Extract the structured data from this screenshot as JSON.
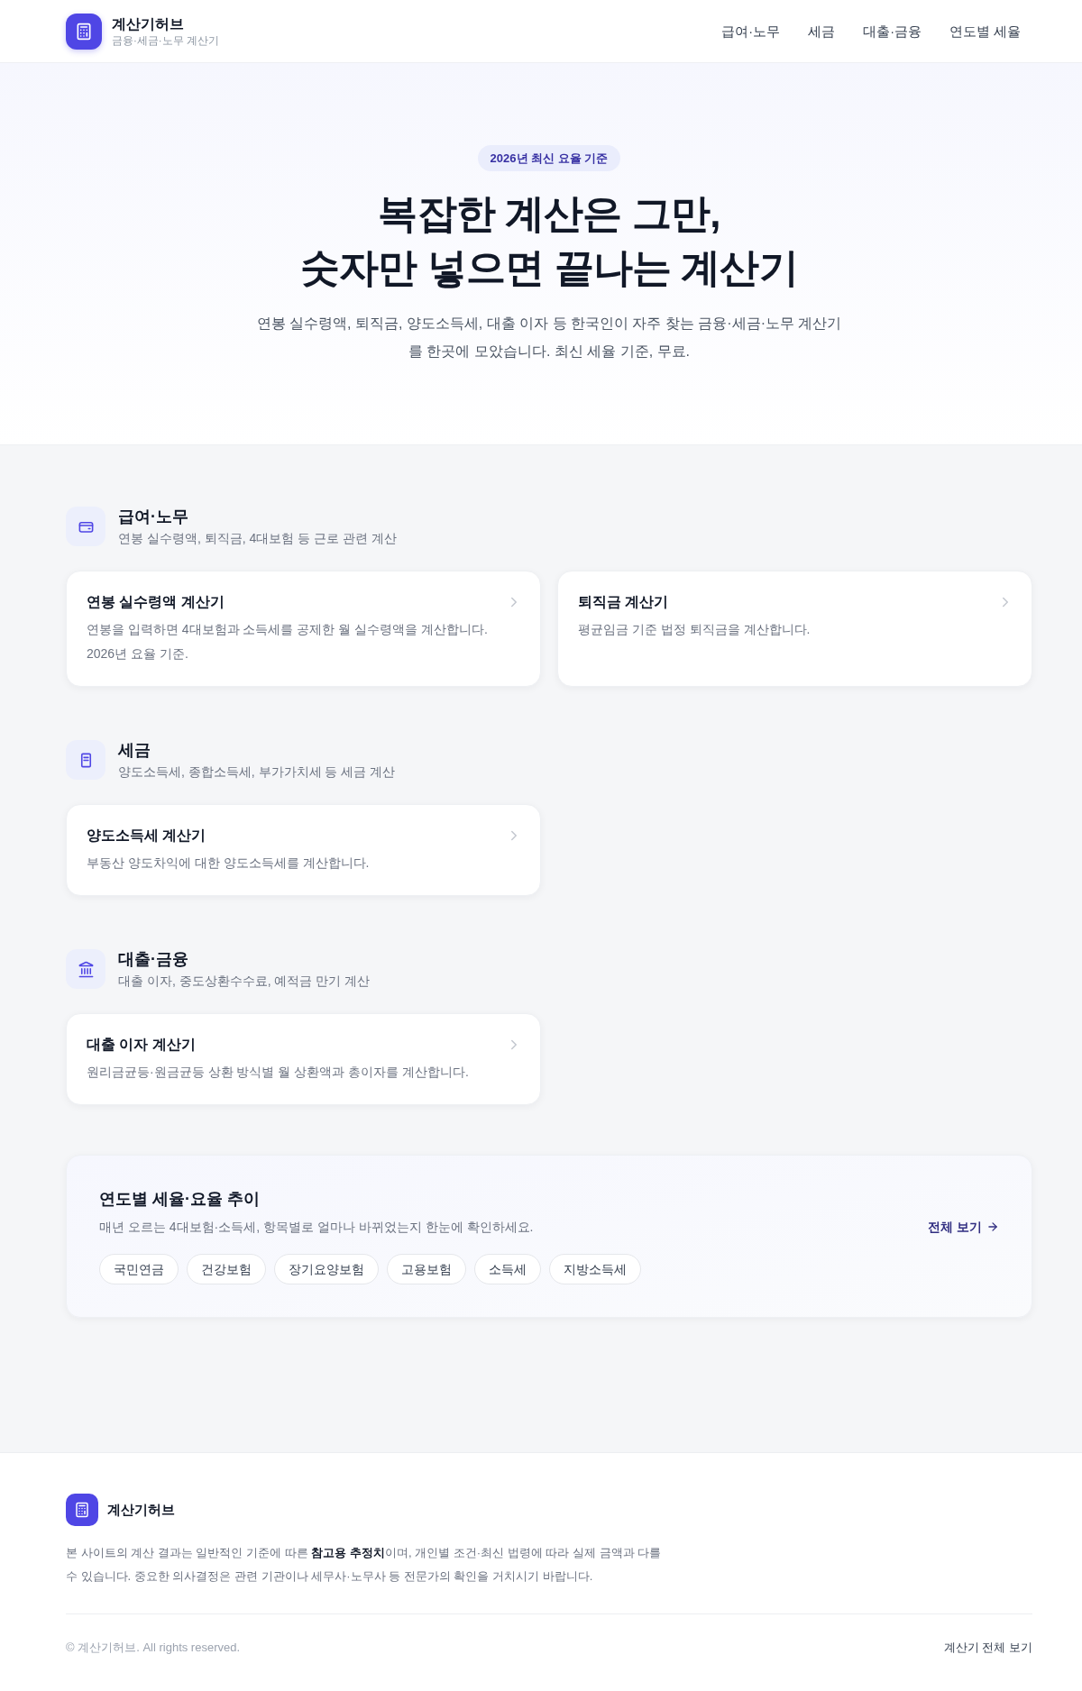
{
  "header": {
    "brand": "계산기허브",
    "tagline": "금융·세금·노무 계산기",
    "nav": [
      "급여·노무",
      "세금",
      "대출·금융",
      "연도별 세율"
    ]
  },
  "hero": {
    "badge": "2026년 최신 요율 기준",
    "title_lines": [
      "복잡한 계산은 그만,",
      "숫자만 넣으면 끝나는 계산기"
    ],
    "description": "연봉 실수령액, 퇴직금, 양도소득세, 대출 이자 등 한국인이 자주 찾는 금융·세금·노무 계산기를 한곳에 모았습니다. 최신 세율 기준, 무료."
  },
  "categories": [
    {
      "kind": "payroll",
      "title": "급여·노무",
      "subtitle": "연봉 실수령액, 퇴직금, 4대보험 등 근로 관련 계산",
      "cards": [
        {
          "title": "연봉 실수령액 계산기",
          "description": "연봉을 입력하면 4대보험과 소득세를 공제한 월 실수령액을 계산합니다. 2026년 요율 기준."
        },
        {
          "title": "퇴직금 계산기",
          "description": "평균임금 기준 법정 퇴직금을 계산합니다."
        }
      ]
    },
    {
      "kind": "tax",
      "title": "세금",
      "subtitle": "양도소득세, 종합소득세, 부가가치세 등 세금 계산",
      "cards": [
        {
          "title": "양도소득세 계산기",
          "description": "부동산 양도차익에 대한 양도소득세를 계산합니다."
        }
      ]
    },
    {
      "kind": "loan",
      "title": "대출·금융",
      "subtitle": "대출 이자, 중도상환수수료, 예적금 만기 계산",
      "cards": [
        {
          "title": "대출 이자 계산기",
          "description": "원리금균등·원금균등 상환 방식별 월 상환액과 총이자를 계산합니다."
        }
      ]
    }
  ],
  "yearly_rates": {
    "title": "연도별 세율·요율 추이",
    "description": "매년 오르는 4대보험·소득세, 항목별로 얼마나 바뀌었는지 한눈에 확인하세요.",
    "link": "전체 보기",
    "chips": [
      "국민연금",
      "건강보험",
      "장기요양보험",
      "고용보험",
      "소득세",
      "지방소득세"
    ]
  },
  "footer": {
    "brand": "계산기허브",
    "disclaimer": "본 사이트의 계산 결과는 일반적인 기준에 따른 **참고용 추정치**이며, 개인별 조건·최신 법령에 따라 실제 금액과 다를 수 있습니다. 중요한 의사결정은 관련 기관이나 세무사·노무사 등 전문가의 확인을 거치시기 바랍니다.",
    "copyright": "© 계산기허브. All rights reserved.",
    "link": "계산기 전체 보기"
  }
}
